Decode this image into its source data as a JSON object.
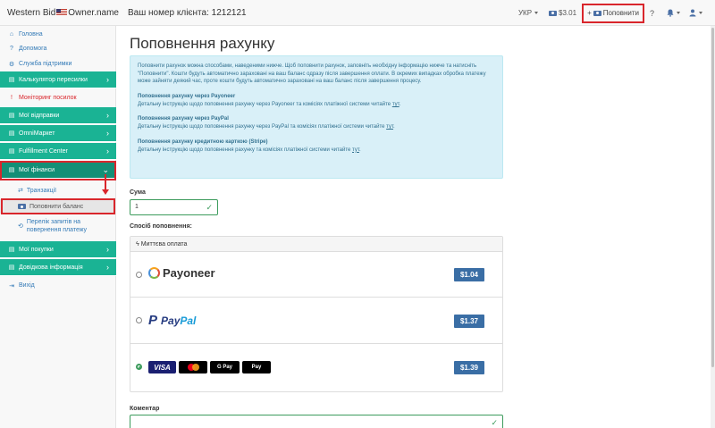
{
  "header": {
    "brand_pre": "Western Bid",
    "brand_post": "Owner.name",
    "client": "Ваш номер клієнта: 1212121",
    "lang": "УКР",
    "balance": "$3.01",
    "topup": "Поповнити",
    "help": "?"
  },
  "sidebar": {
    "items": [
      {
        "label": "Головна"
      },
      {
        "label": "Допомога"
      },
      {
        "label": "Служба підтримки"
      },
      {
        "label": "Калькулятор пересилки"
      },
      {
        "label": "Моніторинг посилок"
      },
      {
        "label": "Мої відправки"
      },
      {
        "label": "OmniМаркет"
      },
      {
        "label": "Fulfillment Center"
      },
      {
        "label": "Мої фінанси"
      },
      {
        "label": "Транзакції"
      },
      {
        "label": "Поповнити баланс"
      },
      {
        "label": "Перелік запитів на повернення платежу"
      },
      {
        "label": "Мої покупки"
      },
      {
        "label": "Довідкова інформація"
      },
      {
        "label": "Вихід"
      }
    ]
  },
  "main": {
    "title": "Поповнення рахунку",
    "info": {
      "intro": "Поповнити рахунок можна способами, наведеними нижче. Щоб поповнити рахунок, заповніть необхідну інформацію нижче та натисніть \"Поповнити\". Кошти будуть автоматично зараховані на ваш баланс одразу після завершення оплати. В окремих випадках обробка платежу може зайняти деякий час, проте кошти будуть автоматично зараховані на ваш баланс після завершення процесу.",
      "payoneer_h": "Поповнення рахунку через Payoneer",
      "payoneer_t": "Детальну інструкцію щодо поповнення рахунку через Payoneer та комісіях платіжної системи читайте",
      "paypal_h": "Поповнення рахунку через PayPal",
      "paypal_t": "Детальну інструкцію щодо поповнення рахунку через PayPal та комісіях платіжної системи читайте",
      "stripe_h": "Поповнення рахунку кредитною карткою (Stripe)",
      "stripe_t": "Детальну інструкцію щодо поповнення рахунку та комісіях платіжної системи читайте",
      "link": "тут",
      "dot": "."
    },
    "amount_label": "Сума",
    "amount_value": "1",
    "method_label": "Спосіб поповнення:",
    "instant": "Миттєва оплата",
    "methods": [
      {
        "name": "Payoneer",
        "fee": "$1.04",
        "selected": false
      },
      {
        "name": "PayPal",
        "fee": "$1.37",
        "selected": false
      },
      {
        "name": "Card",
        "fee": "$1.39",
        "selected": true
      }
    ],
    "card_labels": {
      "visa": "VISA",
      "gpay": "G Pay",
      "apay": " Pay"
    },
    "comment_label": "Коментар"
  },
  "colors": {
    "accent": "#1ab394",
    "accent_dark": "#138f76",
    "highlight": "#d9262c",
    "fee": "#3a6ea5"
  }
}
